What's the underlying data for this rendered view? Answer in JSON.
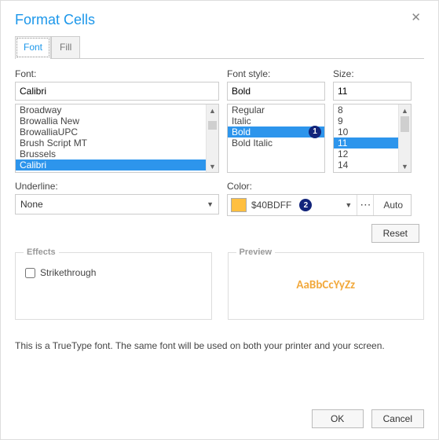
{
  "dialog": {
    "title": "Format Cells",
    "close": "✕"
  },
  "tabs": {
    "font": "Font",
    "fill": "Fill"
  },
  "font": {
    "label": "Font:",
    "value": "Calibri",
    "list": [
      "Broadway",
      "Browallia New",
      "BrowalliaUPC",
      "Brush Script MT",
      "Brussels",
      "Calibri"
    ]
  },
  "fontstyle": {
    "label": "Font style:",
    "value": "Bold",
    "list": [
      "Regular",
      "Italic",
      "Bold",
      "Bold Italic"
    ]
  },
  "size": {
    "label": "Size:",
    "value": "11",
    "list": [
      "8",
      "9",
      "10",
      "11",
      "12",
      "14"
    ]
  },
  "underline": {
    "label": "Underline:",
    "value": "None"
  },
  "color": {
    "label": "Color:",
    "hex": "$40BDFF",
    "swatch": "#ffbf40",
    "auto": "Auto"
  },
  "badges": {
    "one": "1",
    "two": "2"
  },
  "reset": "Reset",
  "effects": {
    "label": "Effects",
    "strikethrough": "Strikethrough"
  },
  "preview": {
    "label": "Preview",
    "sample": "AaBbCcYyZz"
  },
  "footnote": "This is a TrueType font. The same font will be used on both your printer and your screen.",
  "buttons": {
    "ok": "OK",
    "cancel": "Cancel"
  }
}
